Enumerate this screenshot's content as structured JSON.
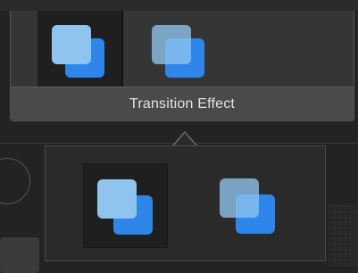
{
  "panel": {
    "label": "Transition Effect",
    "effects": [
      {
        "icon": "overlap-squares-icon",
        "selected": true
      },
      {
        "icon": "transparent-overlap-squares-icon",
        "selected": false
      }
    ]
  },
  "popover": {
    "effects": [
      {
        "icon": "overlap-squares-icon",
        "selected": true
      },
      {
        "icon": "transparent-overlap-squares-icon",
        "selected": false
      }
    ]
  },
  "colors": {
    "accent_back": "#2f86ea",
    "accent_front": "#8fc4ee",
    "panel_bg": "#353535",
    "label_bar_bg": "#4a4a4a",
    "popover_bg": "#2a2a2a"
  }
}
